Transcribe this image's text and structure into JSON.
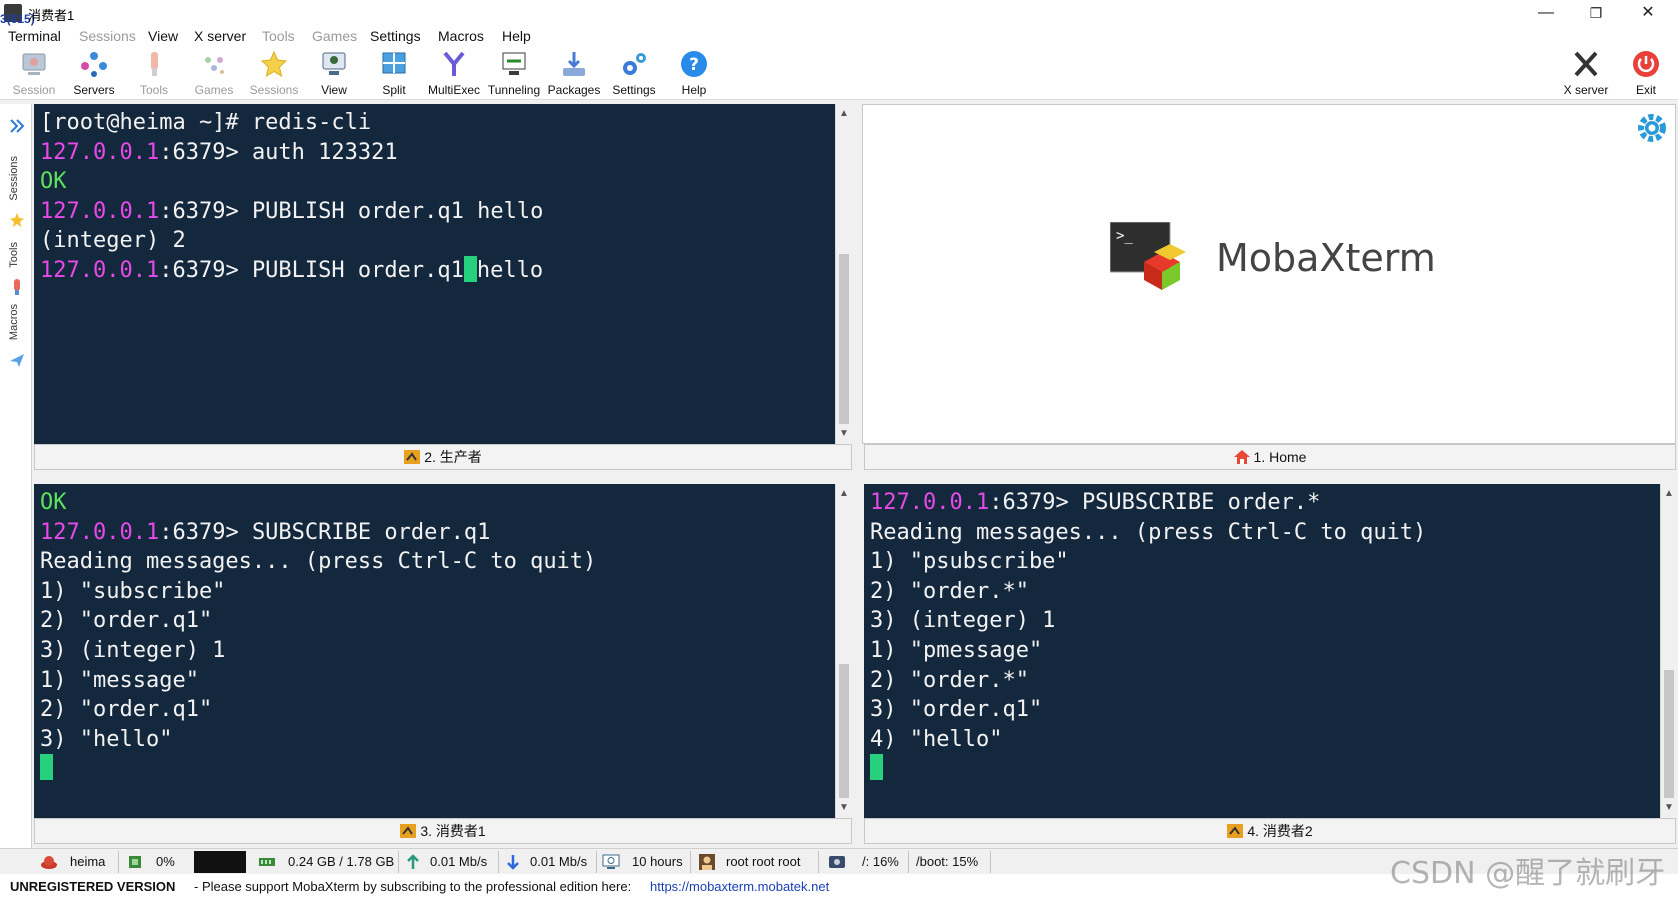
{
  "window": {
    "title": "消费者1",
    "badge": "3(615)",
    "minimize": "—",
    "maximize": "❐",
    "close": "✕"
  },
  "menu": [
    "Terminal",
    "Sessions",
    "View",
    "X server",
    "Tools",
    "Games",
    "Settings",
    "Macros",
    "Help"
  ],
  "toolbar": {
    "session": "Session",
    "servers": "Servers",
    "tools": "Tools",
    "games": "Games",
    "sessions": "Sessions",
    "view": "View",
    "split": "Split",
    "multiexec": "MultiExec",
    "tunneling": "Tunneling",
    "packages": "Packages",
    "settings": "Settings",
    "help": "Help",
    "xserver": "X server",
    "exit": "Exit"
  },
  "sidebar": {
    "sessions": "Sessions",
    "tools": "Tools",
    "macros": "Macros"
  },
  "panes": {
    "producer": {
      "tab": "2. 生产者",
      "prompt_host": "[root@heima ~]# ",
      "cmd1": "redis-cli",
      "ip": "127.0.0.1",
      "port_prompt": ":6379> ",
      "cmd2": "auth 123321",
      "ok": "OK",
      "cmd3": "PUBLISH order.q1 hello",
      "reply": "(integer) 2",
      "cmd4_a": "PUBLISH order.q1",
      "cmd4_b": "hello"
    },
    "home": {
      "tab": "1. Home",
      "brand": "MobaXterm"
    },
    "consumer1": {
      "tab": "3. 消费者1",
      "ok": "OK",
      "ip": "127.0.0.1",
      "port_prompt": ":6379> ",
      "cmd": "SUBSCRIBE order.q1",
      "lines": [
        "Reading messages... (press Ctrl-C to quit)",
        "1) \"subscribe\"",
        "2) \"order.q1\"",
        "3) (integer) 1",
        "1) \"message\"",
        "2) \"order.q1\"",
        "3) \"hello\""
      ]
    },
    "consumer2": {
      "tab": "4. 消费者2",
      "ip": "127.0.0.1",
      "port_prompt": ":6379> ",
      "cmd": "PSUBSCRIBE order.*",
      "lines": [
        "Reading messages... (press Ctrl-C to quit)",
        "1) \"psubscribe\"",
        "2) \"order.*\"",
        "3) (integer) 1",
        "1) \"pmessage\"",
        "2) \"order.*\"",
        "3) \"order.q1\"",
        "4) \"hello\""
      ]
    }
  },
  "status": {
    "host": "heima",
    "cpu": "0%",
    "memory": "0.24 GB / 1.78 GB",
    "upload": "0.01 Mb/s",
    "download": "0.01 Mb/s",
    "uptime": "10 hours",
    "users": "root  root  root",
    "root_disk": "/: 16%",
    "boot_disk": "/boot: 15%"
  },
  "footer": {
    "unregistered": "UNREGISTERED VERSION",
    "message": "-  Please support MobaXterm by subscribing to the professional edition here:",
    "url": "https://mobaxterm.mobatek.net",
    "watermark": "CSDN @醒了就刷牙"
  }
}
